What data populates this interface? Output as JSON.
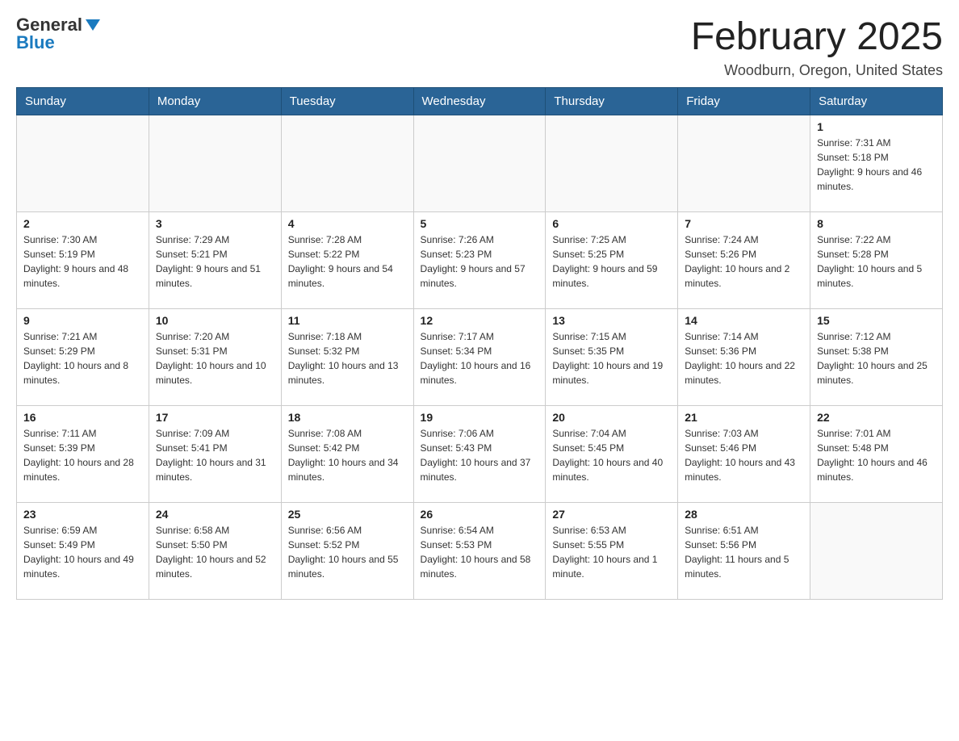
{
  "logo": {
    "general": "General",
    "blue": "Blue"
  },
  "header": {
    "title": "February 2025",
    "subtitle": "Woodburn, Oregon, United States"
  },
  "weekdays": [
    "Sunday",
    "Monday",
    "Tuesday",
    "Wednesday",
    "Thursday",
    "Friday",
    "Saturday"
  ],
  "weeks": [
    [
      {
        "day": "",
        "info": ""
      },
      {
        "day": "",
        "info": ""
      },
      {
        "day": "",
        "info": ""
      },
      {
        "day": "",
        "info": ""
      },
      {
        "day": "",
        "info": ""
      },
      {
        "day": "",
        "info": ""
      },
      {
        "day": "1",
        "info": "Sunrise: 7:31 AM\nSunset: 5:18 PM\nDaylight: 9 hours and 46 minutes."
      }
    ],
    [
      {
        "day": "2",
        "info": "Sunrise: 7:30 AM\nSunset: 5:19 PM\nDaylight: 9 hours and 48 minutes."
      },
      {
        "day": "3",
        "info": "Sunrise: 7:29 AM\nSunset: 5:21 PM\nDaylight: 9 hours and 51 minutes."
      },
      {
        "day": "4",
        "info": "Sunrise: 7:28 AM\nSunset: 5:22 PM\nDaylight: 9 hours and 54 minutes."
      },
      {
        "day": "5",
        "info": "Sunrise: 7:26 AM\nSunset: 5:23 PM\nDaylight: 9 hours and 57 minutes."
      },
      {
        "day": "6",
        "info": "Sunrise: 7:25 AM\nSunset: 5:25 PM\nDaylight: 9 hours and 59 minutes."
      },
      {
        "day": "7",
        "info": "Sunrise: 7:24 AM\nSunset: 5:26 PM\nDaylight: 10 hours and 2 minutes."
      },
      {
        "day": "8",
        "info": "Sunrise: 7:22 AM\nSunset: 5:28 PM\nDaylight: 10 hours and 5 minutes."
      }
    ],
    [
      {
        "day": "9",
        "info": "Sunrise: 7:21 AM\nSunset: 5:29 PM\nDaylight: 10 hours and 8 minutes."
      },
      {
        "day": "10",
        "info": "Sunrise: 7:20 AM\nSunset: 5:31 PM\nDaylight: 10 hours and 10 minutes."
      },
      {
        "day": "11",
        "info": "Sunrise: 7:18 AM\nSunset: 5:32 PM\nDaylight: 10 hours and 13 minutes."
      },
      {
        "day": "12",
        "info": "Sunrise: 7:17 AM\nSunset: 5:34 PM\nDaylight: 10 hours and 16 minutes."
      },
      {
        "day": "13",
        "info": "Sunrise: 7:15 AM\nSunset: 5:35 PM\nDaylight: 10 hours and 19 minutes."
      },
      {
        "day": "14",
        "info": "Sunrise: 7:14 AM\nSunset: 5:36 PM\nDaylight: 10 hours and 22 minutes."
      },
      {
        "day": "15",
        "info": "Sunrise: 7:12 AM\nSunset: 5:38 PM\nDaylight: 10 hours and 25 minutes."
      }
    ],
    [
      {
        "day": "16",
        "info": "Sunrise: 7:11 AM\nSunset: 5:39 PM\nDaylight: 10 hours and 28 minutes."
      },
      {
        "day": "17",
        "info": "Sunrise: 7:09 AM\nSunset: 5:41 PM\nDaylight: 10 hours and 31 minutes."
      },
      {
        "day": "18",
        "info": "Sunrise: 7:08 AM\nSunset: 5:42 PM\nDaylight: 10 hours and 34 minutes."
      },
      {
        "day": "19",
        "info": "Sunrise: 7:06 AM\nSunset: 5:43 PM\nDaylight: 10 hours and 37 minutes."
      },
      {
        "day": "20",
        "info": "Sunrise: 7:04 AM\nSunset: 5:45 PM\nDaylight: 10 hours and 40 minutes."
      },
      {
        "day": "21",
        "info": "Sunrise: 7:03 AM\nSunset: 5:46 PM\nDaylight: 10 hours and 43 minutes."
      },
      {
        "day": "22",
        "info": "Sunrise: 7:01 AM\nSunset: 5:48 PM\nDaylight: 10 hours and 46 minutes."
      }
    ],
    [
      {
        "day": "23",
        "info": "Sunrise: 6:59 AM\nSunset: 5:49 PM\nDaylight: 10 hours and 49 minutes."
      },
      {
        "day": "24",
        "info": "Sunrise: 6:58 AM\nSunset: 5:50 PM\nDaylight: 10 hours and 52 minutes."
      },
      {
        "day": "25",
        "info": "Sunrise: 6:56 AM\nSunset: 5:52 PM\nDaylight: 10 hours and 55 minutes."
      },
      {
        "day": "26",
        "info": "Sunrise: 6:54 AM\nSunset: 5:53 PM\nDaylight: 10 hours and 58 minutes."
      },
      {
        "day": "27",
        "info": "Sunrise: 6:53 AM\nSunset: 5:55 PM\nDaylight: 10 hours and 1 minute."
      },
      {
        "day": "28",
        "info": "Sunrise: 6:51 AM\nSunset: 5:56 PM\nDaylight: 11 hours and 5 minutes."
      },
      {
        "day": "",
        "info": ""
      }
    ]
  ]
}
